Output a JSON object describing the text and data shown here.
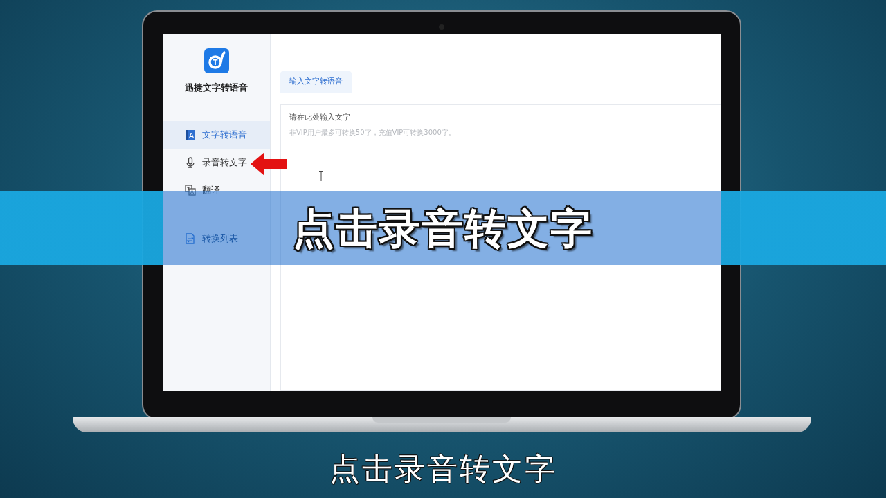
{
  "app": {
    "name": "迅捷文字转语音",
    "logo_letter": "T"
  },
  "sidebar": {
    "items": [
      {
        "label": "文字转语音",
        "kind": "text",
        "icon_letter": "A",
        "selected": true
      },
      {
        "label": "录音转文字",
        "kind": "mic",
        "selected": false
      },
      {
        "label": "翻译",
        "kind": "translate",
        "selected": false
      }
    ],
    "extra_items": [
      {
        "label": "转换列表",
        "kind": "list",
        "selected": false
      }
    ]
  },
  "tabs": [
    {
      "label": "输入文字转语音",
      "selected": true
    }
  ],
  "editor": {
    "placeholder": "请在此处输入文字",
    "hint": "非VIP用户最多可转换50字，充值VIP可转换3000字。"
  },
  "banner": {
    "text": "点击录音转文字"
  },
  "subtitle": "点击录音转文字"
}
